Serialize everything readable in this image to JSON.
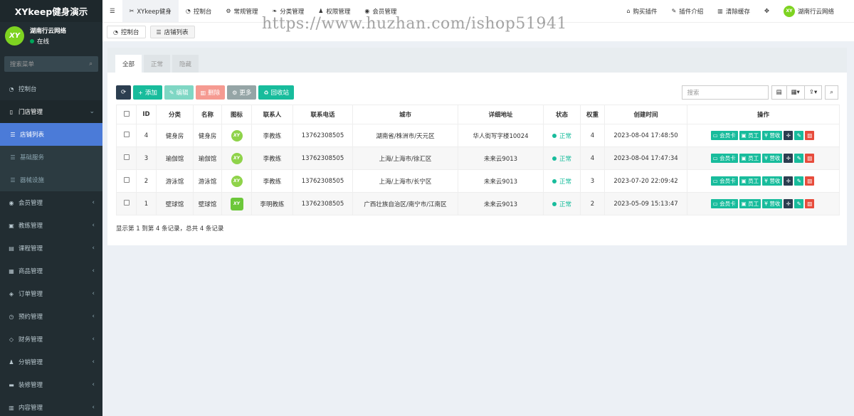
{
  "sidebar": {
    "logo": "XYkeep健身演示",
    "user": {
      "name": "湖南行云网络",
      "status": "在线",
      "avatar_text": "XY"
    },
    "search_placeholder": "搜索菜单",
    "items": [
      {
        "label": "控制台",
        "icon": "dashboard-icon",
        "glyph": "◔"
      },
      {
        "label": "门店管理",
        "icon": "store-icon",
        "glyph": "▯",
        "arrow": "⌄"
      },
      {
        "label": "店铺列表",
        "icon": "list-icon",
        "glyph": "☰"
      },
      {
        "label": "基础服务",
        "icon": "list-icon",
        "glyph": "☰"
      },
      {
        "label": "器械设施",
        "icon": "list-icon",
        "glyph": "☰"
      },
      {
        "label": "会员管理",
        "icon": "user-circle-icon",
        "glyph": "◉",
        "arrow": "‹"
      },
      {
        "label": "教练管理",
        "icon": "id-card-icon",
        "glyph": "▣",
        "arrow": "‹"
      },
      {
        "label": "课程管理",
        "icon": "book-icon",
        "glyph": "▤",
        "arrow": "‹"
      },
      {
        "label": "商品管理",
        "icon": "box-icon",
        "glyph": "▦",
        "arrow": "‹"
      },
      {
        "label": "订单管理",
        "icon": "order-icon",
        "glyph": "◈",
        "arrow": "‹"
      },
      {
        "label": "预约管理",
        "icon": "clock-icon",
        "glyph": "◷",
        "arrow": "‹"
      },
      {
        "label": "财务管理",
        "icon": "diamond-icon",
        "glyph": "◇",
        "arrow": "‹"
      },
      {
        "label": "分销管理",
        "icon": "users-icon",
        "glyph": "♟",
        "arrow": "‹"
      },
      {
        "label": "装修管理",
        "icon": "paint-icon",
        "glyph": "▬",
        "arrow": "‹"
      },
      {
        "label": "内容管理",
        "icon": "file-icon",
        "glyph": "▥",
        "arrow": "‹"
      }
    ]
  },
  "topbar": {
    "menu_icon": "☰",
    "items": [
      {
        "label": "XYkeep健身",
        "glyph": "✂"
      },
      {
        "label": "控制台",
        "glyph": "◔"
      },
      {
        "label": "常规管理",
        "glyph": "⚙"
      },
      {
        "label": "分类管理",
        "glyph": "❧"
      },
      {
        "label": "权限管理",
        "glyph": "♟"
      },
      {
        "label": "会员管理",
        "glyph": "◉"
      }
    ],
    "right": [
      {
        "label": "购买插件",
        "glyph": "⌂"
      },
      {
        "label": "插件介绍",
        "glyph": "✎"
      },
      {
        "label": "清除缓存",
        "glyph": "▥"
      }
    ],
    "fullscreen_glyph": "✥",
    "user_name": "湖南行云网络",
    "user_avatar": "XY"
  },
  "page_tabs": [
    {
      "label": "控制台",
      "glyph": "◔"
    },
    {
      "label": "店铺列表",
      "glyph": "☰"
    }
  ],
  "watermark": "https://www.huzhan.com/ishop51941",
  "filter_tabs": [
    "全部",
    "正常",
    "隐藏"
  ],
  "toolbar": {
    "refresh_glyph": "⟳",
    "add": "添加",
    "edit": "编辑",
    "delete": "删除",
    "more": "更多",
    "recycle": "回收站",
    "search_placeholder": "搜索",
    "view_glyph": "▤",
    "columns_glyph": "▦▾",
    "export_glyph": "⇪▾",
    "search_glyph": "⌕"
  },
  "table": {
    "headers": [
      "ID",
      "分类",
      "名称",
      "图标",
      "联系人",
      "联系电话",
      "城市",
      "详细地址",
      "状态",
      "权重",
      "创建时间",
      "操作"
    ],
    "rows": [
      {
        "id": "4",
        "category": "健身房",
        "name": "健身房",
        "contact": "李教练",
        "phone": "13762308505",
        "city": "湖南省/株洲市/天元区",
        "address": "华人街写字楼10024",
        "status": "正常",
        "weight": "4",
        "created": "2023-08-04 17:48:50",
        "icon_shape": "circle"
      },
      {
        "id": "3",
        "category": "瑜伽馆",
        "name": "瑜伽馆",
        "contact": "李教练",
        "phone": "13762308505",
        "city": "上海/上海市/徐汇区",
        "address": "未来云9013",
        "status": "正常",
        "weight": "4",
        "created": "2023-08-04 17:47:34",
        "icon_shape": "circle"
      },
      {
        "id": "2",
        "category": "游泳馆",
        "name": "游泳馆",
        "contact": "李教练",
        "phone": "13762308505",
        "city": "上海/上海市/长宁区",
        "address": "未来云9013",
        "status": "正常",
        "weight": "3",
        "created": "2023-07-20 22:09:42",
        "icon_shape": "circle"
      },
      {
        "id": "1",
        "category": "壁球馆",
        "name": "壁球馆",
        "contact": "李明教练",
        "phone": "13762308505",
        "city": "广西壮族自治区/南宁市/江南区",
        "address": "未来云9013",
        "status": "正常",
        "weight": "2",
        "created": "2023-05-09 15:13:47",
        "icon_shape": "square"
      }
    ],
    "row_icon_text": "XY",
    "ops": {
      "card": "会员卡",
      "staff": "员工",
      "cashier": "营收"
    }
  },
  "pager": "显示第 1 到第 4 条记录，总共 4 条记录",
  "colors": {
    "sidebar_bg": "#222d32",
    "active_menu": "#4c6fd8",
    "accent": "#18bc9c",
    "danger": "#e74c3c"
  }
}
